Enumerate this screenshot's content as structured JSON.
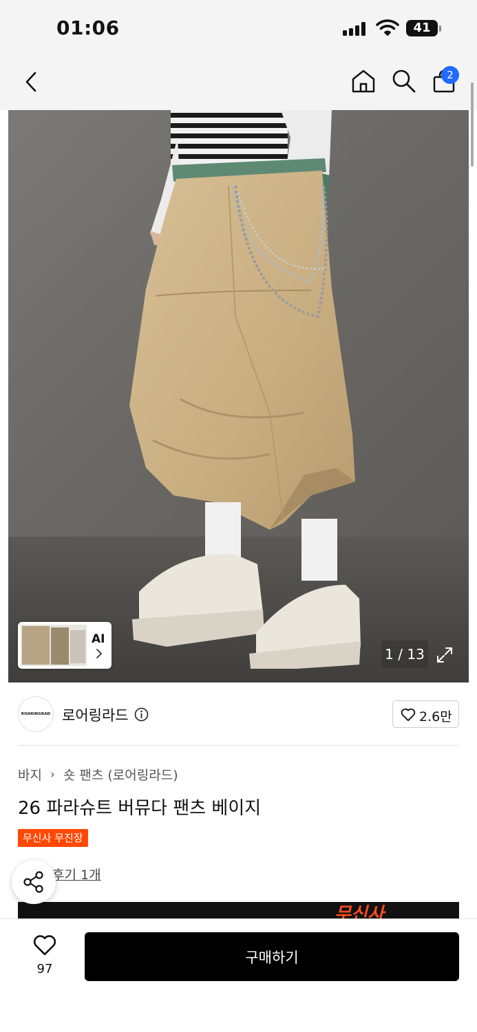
{
  "status_bar": {
    "time": "01:06",
    "battery": "41"
  },
  "nav": {
    "cart_count": "2"
  },
  "gallery": {
    "ai_label": "AI",
    "counter": "1 / 13"
  },
  "brand": {
    "logo_text": "ROARINGRAD",
    "name": "로어링라드",
    "likes": "2.6만"
  },
  "breadcrumb": [
    "바지",
    "숏 팬츠 (로어링라드)"
  ],
  "product": {
    "title": "26 파라슈트 버뮤다 팬츠 베이지",
    "tag": "무신사 무진장",
    "review_link": "후기 1개"
  },
  "banner": {
    "text": "무신사"
  },
  "bottom_bar": {
    "like_count": "97",
    "buy_label": "구매하기"
  },
  "colors": {
    "tag_bg": "#ff4800",
    "badge_bg": "#1f6bff",
    "buy_bg": "#000000"
  },
  "icons": [
    "back-icon",
    "home-icon",
    "search-icon",
    "cart-icon",
    "expand-icon",
    "info-icon",
    "heart-icon",
    "share-icon",
    "star-icon",
    "chevron-right-icon"
  ]
}
